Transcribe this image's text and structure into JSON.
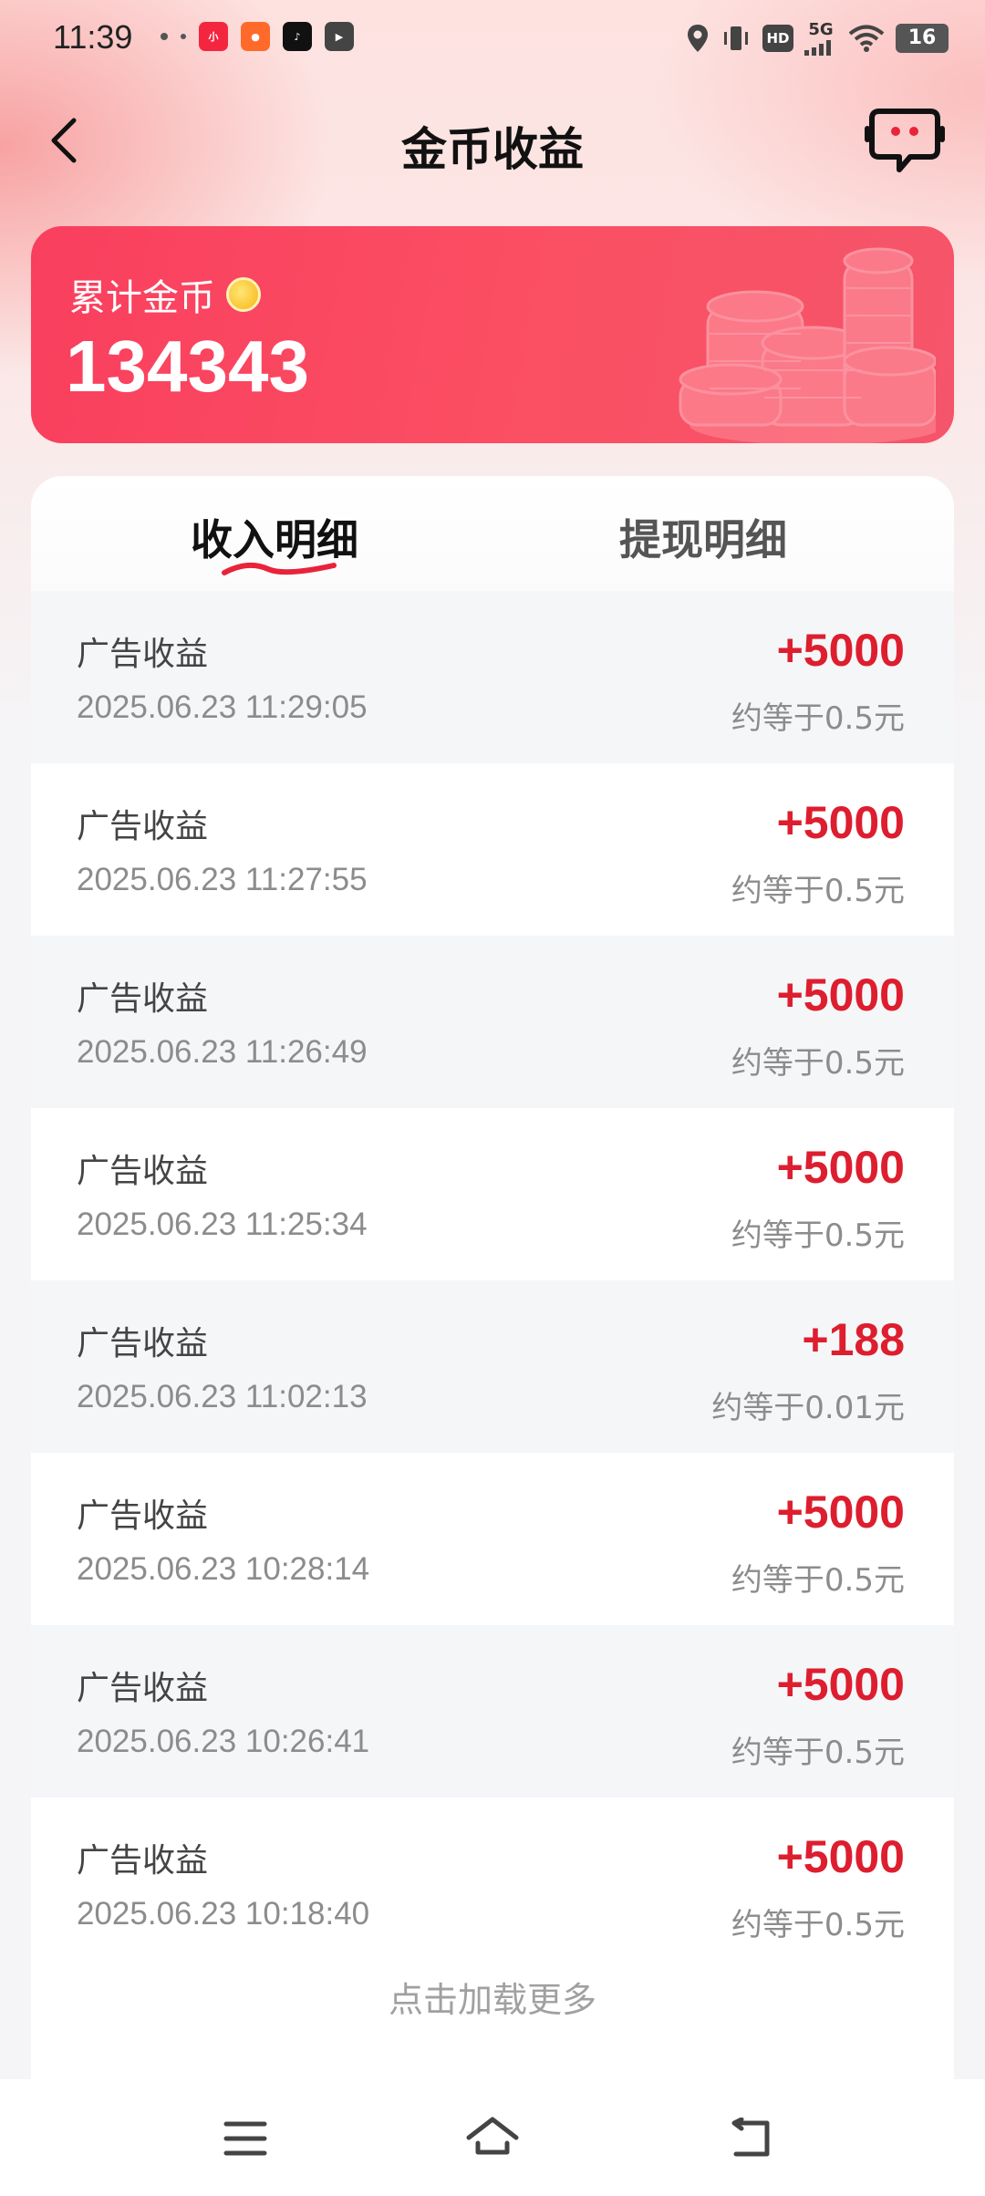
{
  "status_bar": {
    "time": "11:39",
    "network": "5G",
    "hd": "HD",
    "battery": "16",
    "app_icons": [
      "small-dot-icon",
      "xiaohongshu-app-icon",
      "taobao-app-icon",
      "tiktok-app-icon",
      "video-app-icon"
    ]
  },
  "header": {
    "title": "金币收益",
    "back_icon": "chevron-left-icon",
    "service_icon": "customer-service-icon"
  },
  "summary": {
    "label": "累计金币",
    "total": "134343"
  },
  "tabs": [
    {
      "label": "收入明细",
      "active": true
    },
    {
      "label": "提现明细",
      "active": false
    }
  ],
  "records": [
    {
      "type": "广告收益",
      "time": "2025.06.23 11:29:05",
      "amount": "+5000",
      "approx": "约等于0.5元"
    },
    {
      "type": "广告收益",
      "time": "2025.06.23 11:27:55",
      "amount": "+5000",
      "approx": "约等于0.5元"
    },
    {
      "type": "广告收益",
      "time": "2025.06.23 11:26:49",
      "amount": "+5000",
      "approx": "约等于0.5元"
    },
    {
      "type": "广告收益",
      "time": "2025.06.23 11:25:34",
      "amount": "+5000",
      "approx": "约等于0.5元"
    },
    {
      "type": "广告收益",
      "time": "2025.06.23 11:02:13",
      "amount": "+188",
      "approx": "约等于0.01元"
    },
    {
      "type": "广告收益",
      "time": "2025.06.23 10:28:14",
      "amount": "+5000",
      "approx": "约等于0.5元"
    },
    {
      "type": "广告收益",
      "time": "2025.06.23 10:26:41",
      "amount": "+5000",
      "approx": "约等于0.5元"
    },
    {
      "type": "广告收益",
      "time": "2025.06.23 10:18:40",
      "amount": "+5000",
      "approx": "约等于0.5元"
    }
  ],
  "load_more": "点击加载更多",
  "bottom_nav": {
    "menu_icon": "menu-icon",
    "home_icon": "home-icon",
    "back_icon": "back-gesture-icon"
  },
  "colors": {
    "accent": "#f93f5e",
    "amount": "#dd1e2f"
  }
}
